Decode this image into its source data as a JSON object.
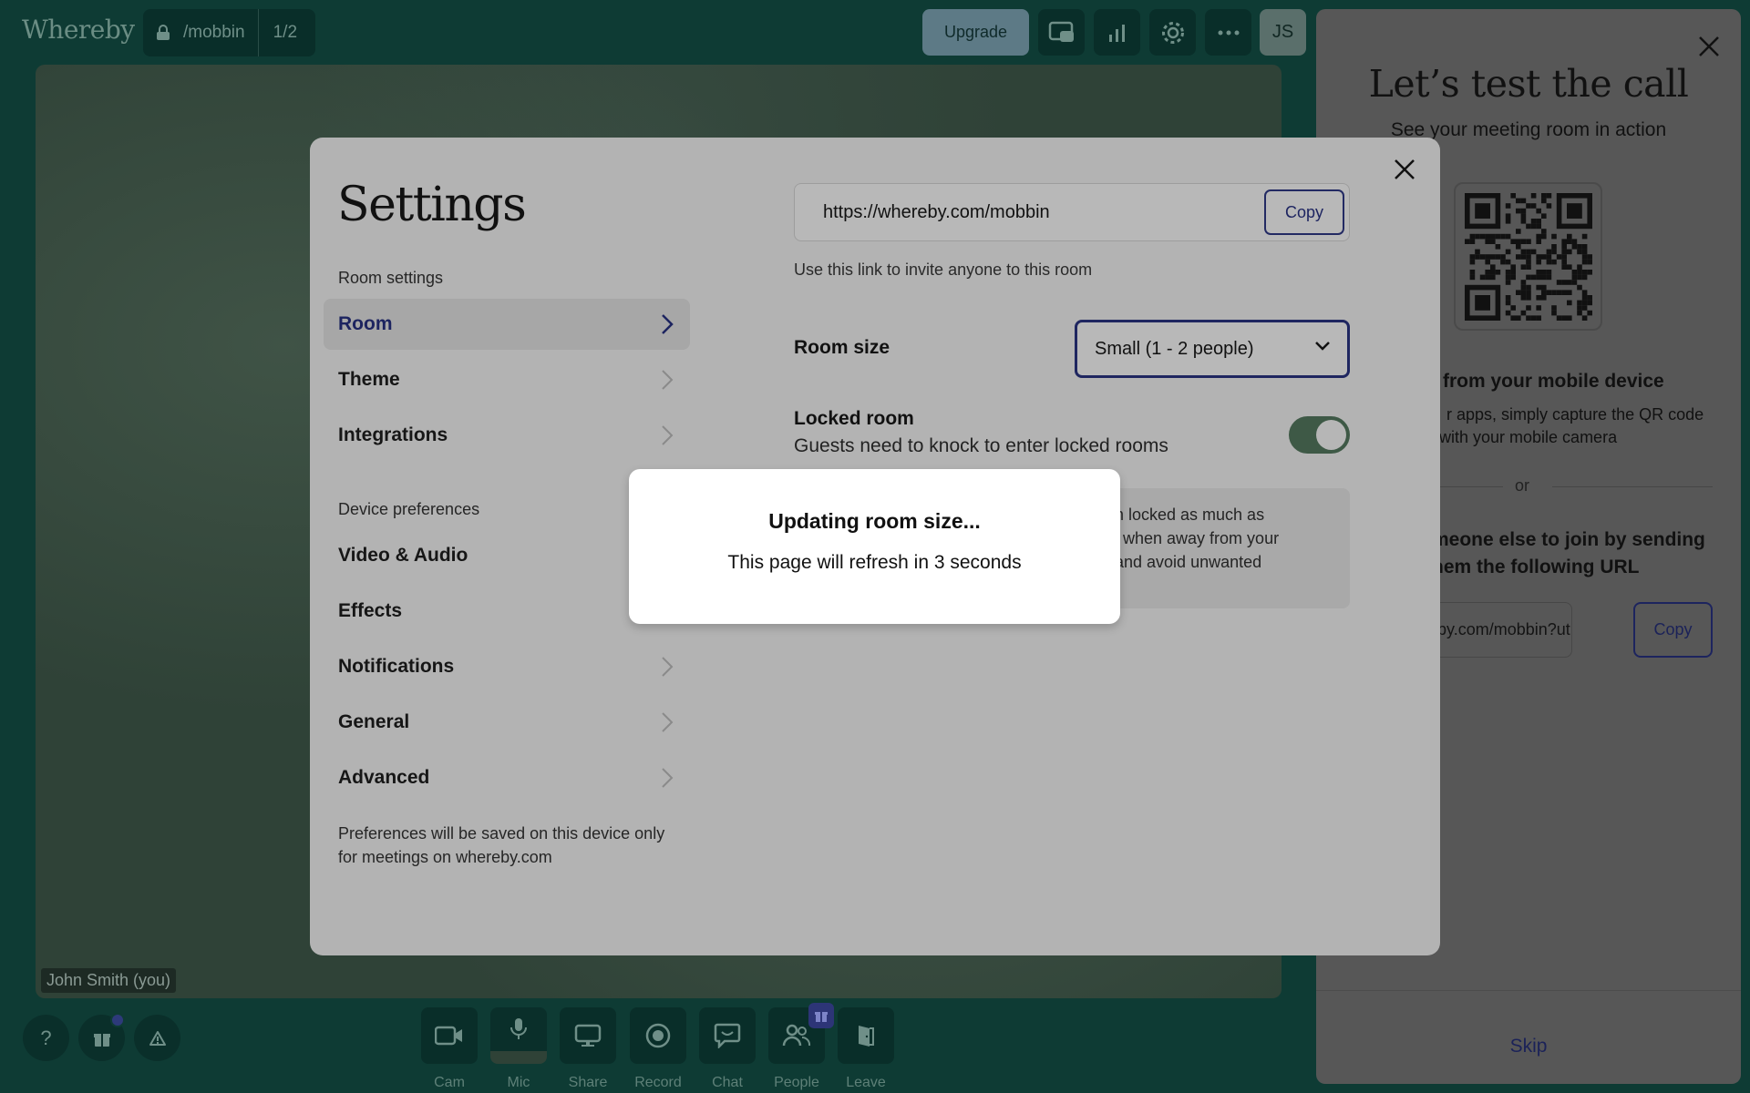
{
  "brand": "Whereby",
  "topbar": {
    "room_name": "/mobbin",
    "participants": "1/2",
    "upgrade_label": "Upgrade",
    "avatar_initials": "JS"
  },
  "video": {
    "self_label": "John Smith (you)"
  },
  "toolbar": [
    {
      "label": "Cam",
      "icon": "camera-icon"
    },
    {
      "label": "Mic",
      "icon": "microphone-icon"
    },
    {
      "label": "Share",
      "icon": "screen-share-icon"
    },
    {
      "label": "Record",
      "icon": "record-icon"
    },
    {
      "label": "Chat",
      "icon": "chat-icon"
    },
    {
      "label": "People",
      "icon": "people-icon"
    },
    {
      "label": "Leave",
      "icon": "leave-door-icon"
    }
  ],
  "side_panel": {
    "title": "Let’s test the call",
    "subtitle": "See your meeting room in action",
    "mobile_heading": "from your mobile device",
    "mobile_text_1": "r apps, simply capture the QR code",
    "mobile_text_2": "with your mobile camera",
    "or_label": "or",
    "invite_heading_1": "meone else to join by sending",
    "invite_heading_2": "hem the following URL",
    "invite_url": "ereby.com/mobbin?utm_",
    "copy_label": "Copy",
    "skip_label": "Skip"
  },
  "settings": {
    "title": "Settings",
    "room_settings_label": "Room settings",
    "nav_room": [
      "Room",
      "Theme",
      "Integrations"
    ],
    "device_preferences_label": "Device preferences",
    "nav_device": [
      "Video & Audio",
      "Effects",
      "Notifications",
      "General",
      "Advanced"
    ],
    "pref_note": "Preferences will be saved on this device only for meetings on whereby.com",
    "room_url": "https://whereby.com/mobbin",
    "copy_label": "Copy",
    "url_hint": "Use this link to invite anyone to this room",
    "room_size_label": "Room size",
    "room_size_value": "Small (1 - 2 people)",
    "locked_label": "Locked room",
    "locked_sub": "Guests need to knock to enter locked rooms",
    "locked_on": true,
    "info_text": "m locked as much as\ns when away from your\n and avoid unwanted"
  },
  "modal": {
    "title": "Updating room size...",
    "message": "This page will refresh in 3 seconds"
  },
  "colors": {
    "background": "#0e3b34",
    "accent": "#1d2460",
    "toggle_on": "#3e5946"
  }
}
